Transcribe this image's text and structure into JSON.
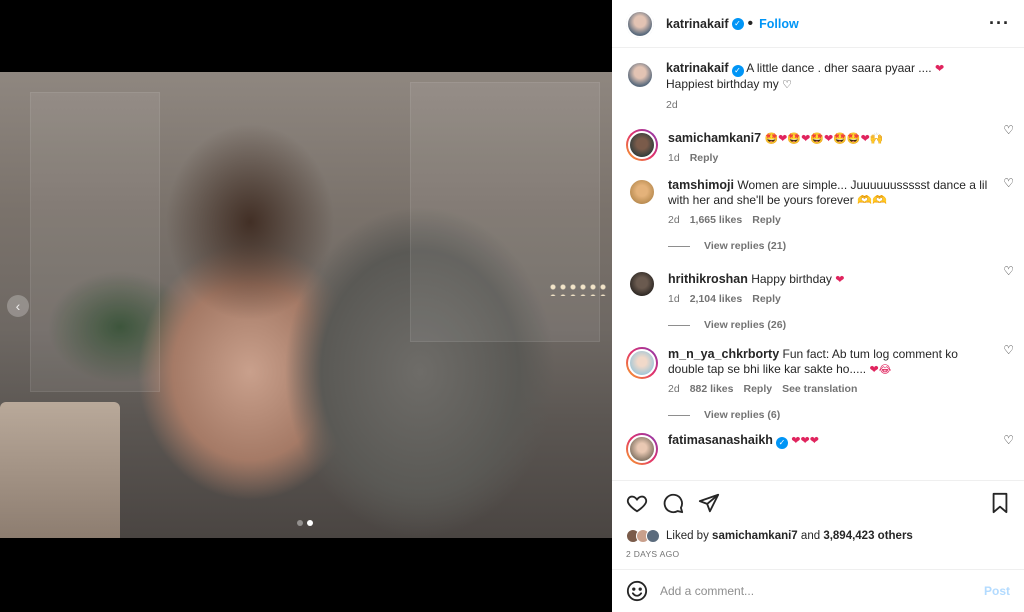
{
  "colors": {
    "accent": "#0095f6",
    "heart": "#e0245e",
    "muted": "#737373"
  },
  "header": {
    "username": "katrinakaif",
    "follow_label": "Follow",
    "more_icon": "more-horizontal-icon"
  },
  "caption": {
    "username": "katrinakaif",
    "text": "A little dance . dher saara pyaar ....",
    "emoji": "❤",
    "line2": "Happiest birthday my",
    "line2_emoji": "♡",
    "time": "2d"
  },
  "comments": [
    {
      "username": "samichamkani7",
      "text": "🤩❤🤩❤🤩❤🤩🤩❤🙌",
      "time": "1d",
      "reply": "Reply"
    },
    {
      "username": "tamshimoji",
      "text": "Women are simple... Juuuuuussssst dance a lil with her and she'll be yours forever 🫶🫶",
      "time": "2d",
      "likes": "1,665 likes",
      "reply": "Reply",
      "view_replies": "View replies (21)"
    },
    {
      "username": "hrithikroshan",
      "text": "Happy birthday",
      "emoji": "❤",
      "time": "1d",
      "likes": "2,104 likes",
      "reply": "Reply",
      "view_replies": "View replies (26)"
    },
    {
      "username": "m_n_ya_chkrborty",
      "text": "Fun fact: Ab tum log comment ko double tap se bhi like kar sakte ho.....",
      "emoji": "❤😂",
      "time": "2d",
      "likes": "882 likes",
      "reply": "Reply",
      "see_translation": "See translation",
      "view_replies": "View replies (6)"
    },
    {
      "username": "fatimasanashaikh",
      "emoji": "❤❤❤"
    }
  ],
  "likes": {
    "prefix": "Liked by",
    "user": "samichamkani7",
    "middle": "and",
    "count": "3,894,423 others"
  },
  "time_ago": "2 DAYS AGO",
  "add_comment": {
    "placeholder": "Add a comment...",
    "post_label": "Post"
  },
  "carousel": {
    "current": 2,
    "total": 2
  }
}
